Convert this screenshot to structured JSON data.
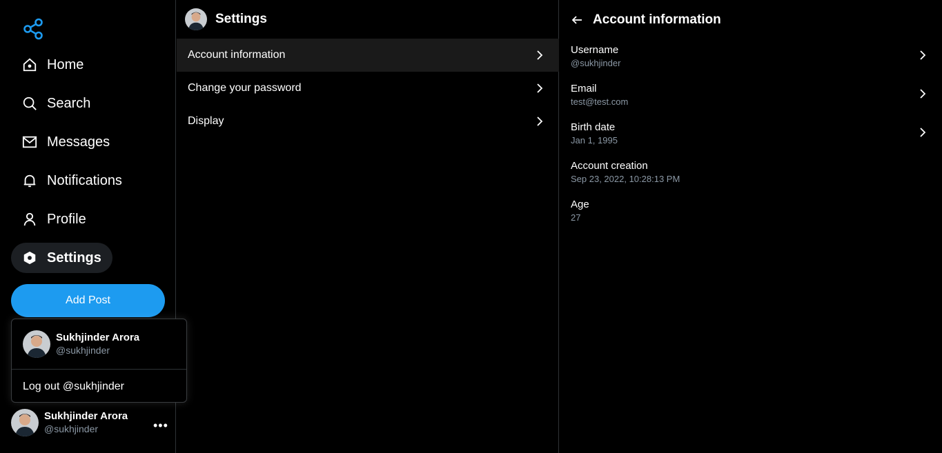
{
  "nav": {
    "items": [
      {
        "label": "Home",
        "icon": "home-icon"
      },
      {
        "label": "Search",
        "icon": "search-icon"
      },
      {
        "label": "Messages",
        "icon": "mail-icon"
      },
      {
        "label": "Notifications",
        "icon": "bell-icon"
      },
      {
        "label": "Profile",
        "icon": "user-icon"
      },
      {
        "label": "Settings",
        "icon": "gear-icon",
        "active": true
      }
    ],
    "add_post_label": "Add Post"
  },
  "account_popup": {
    "name": "Sukhjinder Arora",
    "handle": "@sukhjinder",
    "logout_label": "Log out @sukhjinder"
  },
  "current_user": {
    "name": "Sukhjinder Arora",
    "handle": "@sukhjinder",
    "more_label": "•••"
  },
  "settings": {
    "title": "Settings",
    "items": [
      {
        "label": "Account information",
        "selected": true
      },
      {
        "label": "Change your password"
      },
      {
        "label": "Display"
      }
    ]
  },
  "account_info": {
    "title": "Account information",
    "fields": [
      {
        "key": "Username",
        "value": "@sukhjinder",
        "editable": true
      },
      {
        "key": "Email",
        "value": "test@test.com",
        "editable": true
      },
      {
        "key": "Birth date",
        "value": "Jan 1, 1995",
        "editable": true
      },
      {
        "key": "Account creation",
        "value": "Sep 23, 2022, 10:28:13 PM",
        "editable": false
      },
      {
        "key": "Age",
        "value": "27",
        "editable": false
      }
    ]
  },
  "colors": {
    "accent": "#1d9bf0",
    "background": "#000000",
    "muted": "#8b98a5",
    "border": "#2f3336"
  }
}
